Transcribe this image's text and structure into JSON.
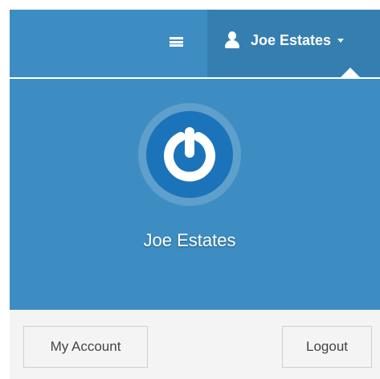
{
  "navbar": {
    "menu_icon": "hamburger-menu-icon",
    "user_icon": "user-icon",
    "user_name": "Joe Estates",
    "caret_icon": "caret-down-icon",
    "background": "#3d8dc2",
    "active_background": "#357fb0"
  },
  "user_panel": {
    "avatar_icon": "power-logo-icon",
    "user_name": "Joe Estates",
    "background": "#3d8dc2",
    "avatar_color": "#1b74b9"
  },
  "footer": {
    "account_label": "My Account",
    "logout_label": "Logout",
    "background": "#f4f4f4"
  }
}
